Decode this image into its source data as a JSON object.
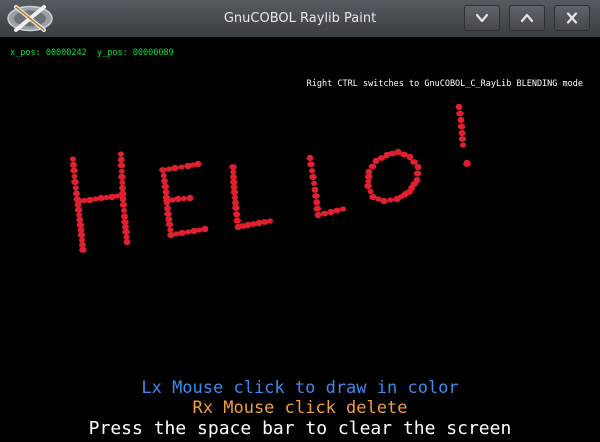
{
  "window": {
    "title": "GnuCOBOL Raylib Paint",
    "icons": {
      "app": "gnucobol-x-logo-icon",
      "minimize": "chevron-down-icon",
      "maximize": "chevron-up-icon",
      "close": "close-icon"
    }
  },
  "status": {
    "position": "x_pos: 00000242  y_pos: 00000089"
  },
  "hint": "Right CTRL switches to GnuCOBOL_C_RayLib BLENDING mode",
  "drawing": {
    "text": "HELLO!",
    "color": "#e0202e",
    "style": "freehand dotted brush strokes"
  },
  "instructions": {
    "draw": "Lx Mouse click to draw in color",
    "draw_color": "#3a8cf0",
    "delete": "Rx Mouse click delete",
    "delete_color": "#f2a03c",
    "clear": "Press the space bar to clear the screen",
    "clear_color": "#ffffff"
  }
}
